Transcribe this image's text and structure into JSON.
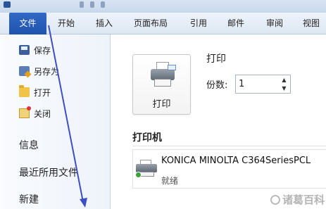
{
  "ribbon": {
    "tabs": [
      {
        "label": "文件",
        "active": true
      },
      {
        "label": "开始"
      },
      {
        "label": "插入"
      },
      {
        "label": "页面布局"
      },
      {
        "label": "引用"
      },
      {
        "label": "邮件"
      },
      {
        "label": "审阅"
      },
      {
        "label": "视图"
      }
    ],
    "accent_color": "#2b5fb8"
  },
  "left_menu": {
    "commands": [
      {
        "label": "保存",
        "icon": "save-icon"
      },
      {
        "label": "另存为",
        "icon": "save-as-icon"
      },
      {
        "label": "打开",
        "icon": "open-folder-icon"
      },
      {
        "label": "关闭",
        "icon": "close-document-icon"
      }
    ],
    "sections": [
      "信息",
      "最近所用文件",
      "新建"
    ]
  },
  "print_pane": {
    "print_button_label": "打印",
    "title": "打印",
    "copies_label": "份数:",
    "copies_value": "1",
    "printer_heading": "打印机",
    "printer": {
      "name": "KONICA MINOLTA C364SeriesPCL",
      "status": "就绪"
    }
  },
  "watermark": {
    "text": "诸葛百科"
  },
  "annotation_arrow_color": "#3d4fc4"
}
